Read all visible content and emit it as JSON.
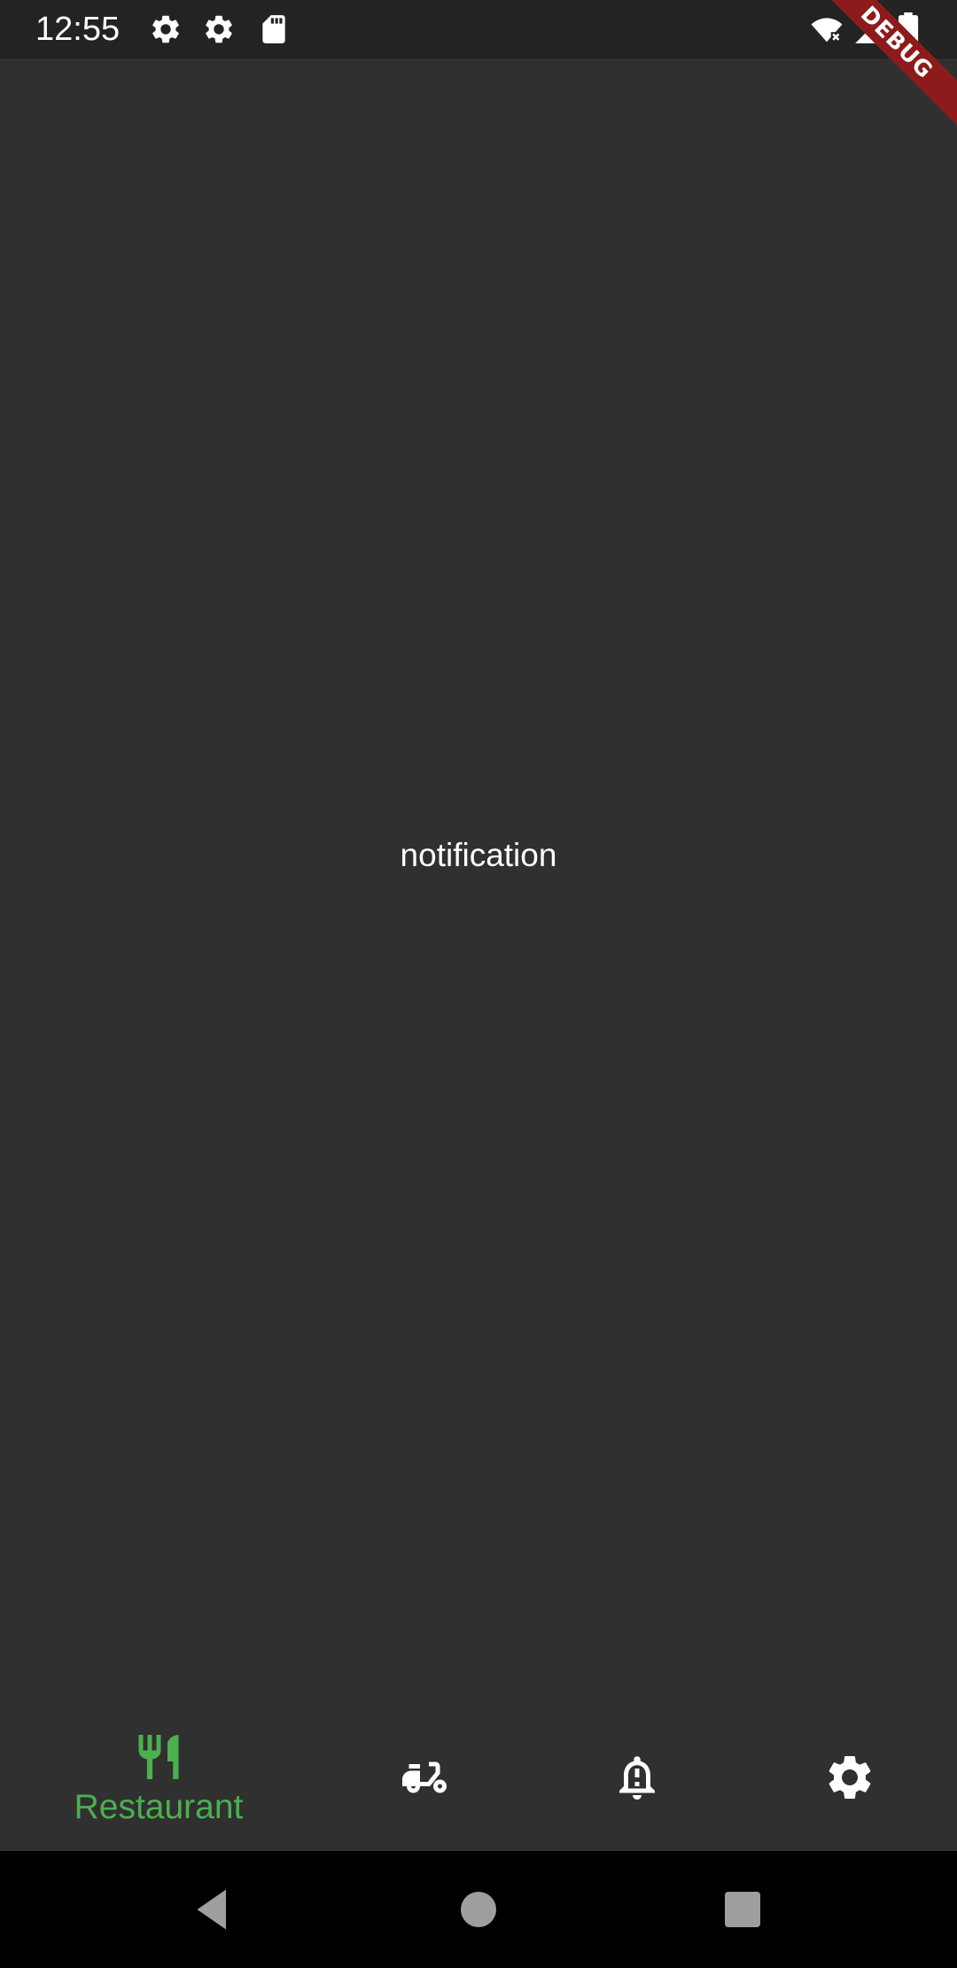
{
  "status_bar": {
    "time": "12:55",
    "icons": [
      "gear-icon",
      "gear-icon",
      "sd-card-icon",
      "wifi-off-icon",
      "cell-signal-icon",
      "battery-icon"
    ]
  },
  "debug_banner": {
    "label": "DEBUG",
    "color": "#8d1b1b"
  },
  "main": {
    "text": "notification"
  },
  "bottom_nav": {
    "items": [
      {
        "icon": "restaurant-icon",
        "label": "Restaurant",
        "active": true
      },
      {
        "icon": "delivery-scooter-icon",
        "label": "",
        "active": false
      },
      {
        "icon": "notification-alert-icon",
        "label": "",
        "active": false
      },
      {
        "icon": "settings-icon",
        "label": "",
        "active": false
      }
    ],
    "active_color": "#4caf50",
    "inactive_color": "#ffffff"
  },
  "system_nav": {
    "buttons": [
      "back-icon",
      "home-icon",
      "recents-icon"
    ]
  },
  "colors": {
    "background": "#303030",
    "status_bar": "#232323",
    "system_nav": "#000000"
  }
}
